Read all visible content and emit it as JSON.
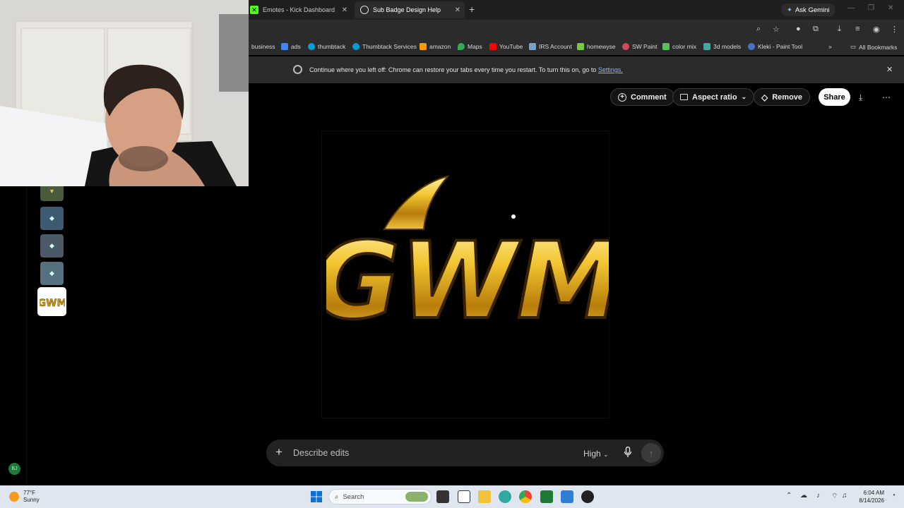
{
  "browser": {
    "tabs": [
      {
        "title": "Emotes - Kick Dashboard",
        "favicon_color": "#53fc18"
      },
      {
        "title": "Sub Badge Design Help",
        "favicon_color": "#dddddd"
      }
    ],
    "ask_gemini": "Ask Gemini",
    "bookmarks": [
      {
        "label": "business",
        "color": ""
      },
      {
        "label": "ads",
        "color": "#4285f4"
      },
      {
        "label": "thumbtack",
        "color": "#009fd9"
      },
      {
        "label": "Thumbtack Services",
        "color": "#009fd9"
      },
      {
        "label": "amazon",
        "color": "#ff9900"
      },
      {
        "label": "Maps",
        "color": "#34a853"
      },
      {
        "label": "YouTube",
        "color": "#ff0000"
      },
      {
        "label": "IRS Account",
        "color": "#7aa2c8"
      },
      {
        "label": "homewyse",
        "color": "#7ac943"
      },
      {
        "label": "SW Paint",
        "color": "#d04a5a"
      },
      {
        "label": "color mix",
        "color": "#59c05a"
      },
      {
        "label": "3d models",
        "color": "#3fa8a0"
      },
      {
        "label": "Kleki - Paint Tool",
        "color": "#4a70c8"
      }
    ],
    "all_bookmarks": "All Bookmarks",
    "infobar": {
      "text": "Continue where you left off: Chrome can restore your tabs every time you restart. To turn this on, go to",
      "link": "Settings."
    }
  },
  "page": {
    "comment_label": "Comment",
    "aspect_label": "Aspect ratio",
    "remove_label": "Remove",
    "share_label": "Share",
    "logo_text": "GWM",
    "edit_placeholder": "Describe edits",
    "quality": "High",
    "avatar_initials": "BJ"
  },
  "taskbar": {
    "temp": "77°F",
    "condition": "Sunny",
    "search_label": "Search",
    "time": "6:04 AM",
    "date": "8/14/2026"
  }
}
